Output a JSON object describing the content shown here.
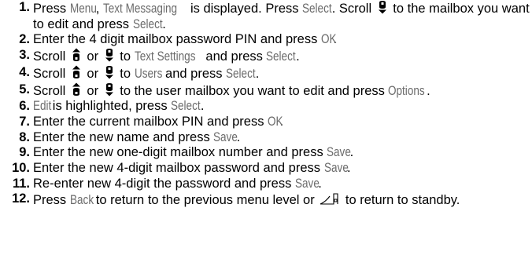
{
  "steps": [
    {
      "num": "1.",
      "parts": [
        {
          "t": "text",
          "v": "Press "
        },
        {
          "t": "kw",
          "v": "Menu"
        },
        {
          "t": "text",
          "v": ", "
        },
        {
          "t": "kw",
          "v": "Text Messaging"
        },
        {
          "t": "text",
          "v": " is displayed. Press "
        },
        {
          "t": "kw",
          "v": "Select"
        },
        {
          "t": "text",
          "v": ". Scroll "
        },
        {
          "t": "icon",
          "name": "scroll-down-icon"
        },
        {
          "t": "text",
          "v": " to the mailbox you want to edit and press "
        },
        {
          "t": "kw",
          "v": "Select"
        },
        {
          "t": "text",
          "v": "."
        }
      ]
    },
    {
      "num": "2.",
      "parts": [
        {
          "t": "text",
          "v": "Enter the 4 digit mailbox password PIN and press "
        },
        {
          "t": "kw",
          "v": "OK"
        },
        {
          "t": "text",
          "v": "."
        }
      ]
    },
    {
      "num": "3.",
      "parts": [
        {
          "t": "text",
          "v": "Scroll "
        },
        {
          "t": "icon",
          "name": "scroll-up-icon"
        },
        {
          "t": "text",
          "v": " or "
        },
        {
          "t": "icon",
          "name": "scroll-down-icon"
        },
        {
          "t": "text",
          "v": " to "
        },
        {
          "t": "kw",
          "v": "Text Settings"
        },
        {
          "t": "text",
          "v": " and press "
        },
        {
          "t": "kw",
          "v": "Select"
        },
        {
          "t": "text",
          "v": "."
        }
      ]
    },
    {
      "num": "4.",
      "parts": [
        {
          "t": "text",
          "v": "Scroll "
        },
        {
          "t": "icon",
          "name": "scroll-up-icon"
        },
        {
          "t": "text",
          "v": " or "
        },
        {
          "t": "icon",
          "name": "scroll-down-icon"
        },
        {
          "t": "text",
          "v": " to "
        },
        {
          "t": "kw",
          "v": "Users"
        },
        {
          "t": "text",
          "v": " and press "
        },
        {
          "t": "kw",
          "v": "Select"
        },
        {
          "t": "text",
          "v": "."
        }
      ]
    },
    {
      "num": "5.",
      "parts": [
        {
          "t": "text",
          "v": "Scroll "
        },
        {
          "t": "icon",
          "name": "scroll-up-icon"
        },
        {
          "t": "text",
          "v": " or "
        },
        {
          "t": "icon",
          "name": "scroll-down-icon"
        },
        {
          "t": "text",
          "v": " to the user mailbox you want to edit and press "
        },
        {
          "t": "kw",
          "v": "Options"
        },
        {
          "t": "text",
          "v": "."
        }
      ]
    },
    {
      "num": "6.",
      "parts": [
        {
          "t": "kw",
          "v": "Edit"
        },
        {
          "t": "text",
          "v": " is highlighted, press "
        },
        {
          "t": "kw",
          "v": "Select"
        },
        {
          "t": "text",
          "v": "."
        }
      ]
    },
    {
      "num": "7.",
      "parts": [
        {
          "t": "text",
          "v": "Enter the current mailbox PIN and press "
        },
        {
          "t": "kw",
          "v": "OK"
        },
        {
          "t": "text",
          "v": "."
        }
      ]
    },
    {
      "num": "8.",
      "parts": [
        {
          "t": "text",
          "v": "Enter the new name and press "
        },
        {
          "t": "kw",
          "v": "Save"
        },
        {
          "t": "text",
          "v": "."
        }
      ]
    },
    {
      "num": "9.",
      "parts": [
        {
          "t": "text",
          "v": "Enter the new one-digit mailbox number and press "
        },
        {
          "t": "kw",
          "v": "Save"
        },
        {
          "t": "text",
          "v": "."
        }
      ]
    },
    {
      "num": "10.",
      "parts": [
        {
          "t": "text",
          "v": "Enter the new 4-digit mailbox password and press "
        },
        {
          "t": "kw",
          "v": "Save"
        },
        {
          "t": "text",
          "v": "."
        }
      ]
    },
    {
      "num": "11.",
      "parts": [
        {
          "t": "text",
          "v": "Re-enter new 4-digit the password and press "
        },
        {
          "t": "kw",
          "v": "Save"
        },
        {
          "t": "text",
          "v": "."
        }
      ]
    },
    {
      "num": "12.",
      "parts": [
        {
          "t": "text",
          "v": "Press "
        },
        {
          "t": "kw",
          "v": "Back"
        },
        {
          "t": "text",
          "v": " to return to the previous menu level or "
        },
        {
          "t": "icon",
          "name": "end-call-icon"
        },
        {
          "t": "text",
          "v": " to return to standby."
        }
      ]
    }
  ],
  "colors": {
    "text": "#000000",
    "keyword": "#6b6b6b"
  }
}
